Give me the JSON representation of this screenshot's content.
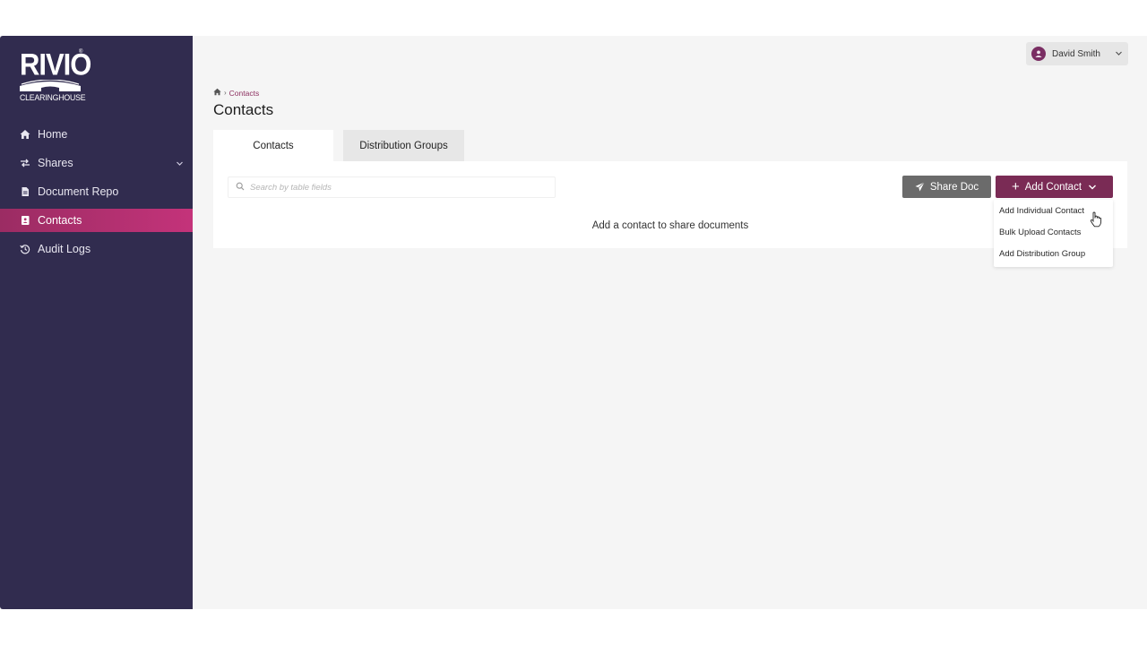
{
  "brand": {
    "name": "RIVIO",
    "tm": "®",
    "subtitle": "CLEARINGHOUSE"
  },
  "sidebar": {
    "items": [
      {
        "label": "Home",
        "icon": "home-icon"
      },
      {
        "label": "Shares",
        "icon": "share-icon",
        "expandable": true
      },
      {
        "label": "Document Repo",
        "icon": "document-icon"
      },
      {
        "label": "Contacts",
        "icon": "contact-card-icon",
        "active": true
      },
      {
        "label": "Audit Logs",
        "icon": "history-icon"
      }
    ]
  },
  "user": {
    "name": "David Smith"
  },
  "breadcrumb": {
    "home_icon": "home-icon",
    "current": "Contacts"
  },
  "page": {
    "title": "Contacts"
  },
  "tabs": [
    {
      "label": "Contacts",
      "active": true
    },
    {
      "label": "Distribution Groups",
      "active": false
    }
  ],
  "search": {
    "placeholder": "Search by table fields",
    "value": ""
  },
  "toolbar": {
    "share_label": "Share Doc",
    "add_label": "Add Contact"
  },
  "add_menu": {
    "items": [
      "Add Individual Contact",
      "Bulk Upload Contacts",
      "Add Distribution Group"
    ]
  },
  "empty_state": {
    "message": "Add a contact to share documents"
  },
  "colors": {
    "sidebar_bg": "#312c4f",
    "active_nav": "#c4337a",
    "primary": "#7a2b55",
    "secondary_button": "#6b6b6b",
    "page_bg": "#f5f5f5"
  }
}
